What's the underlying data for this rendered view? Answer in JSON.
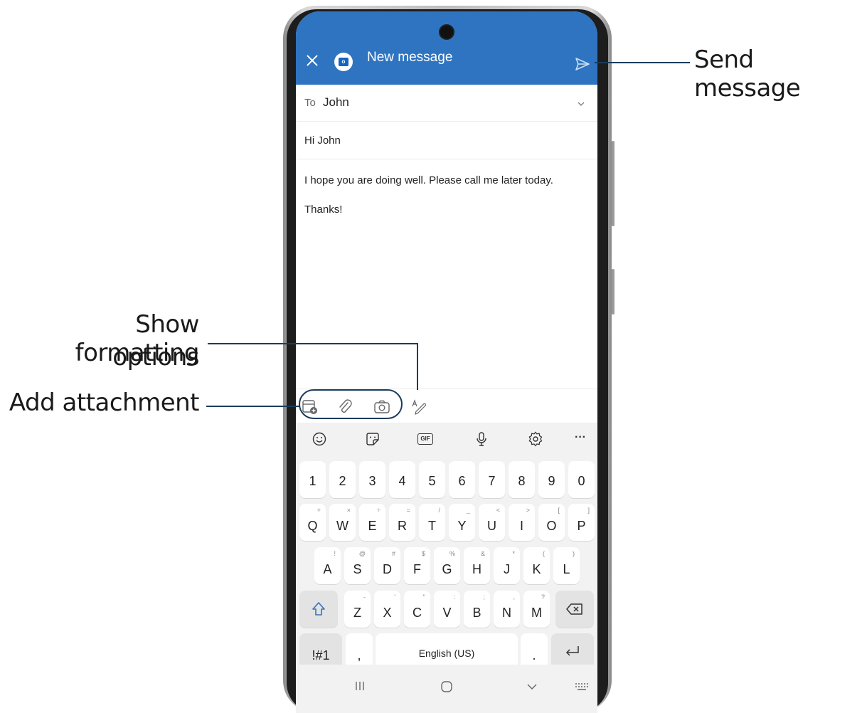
{
  "header": {
    "title": "New message"
  },
  "compose": {
    "to_label": "To",
    "to_value": "John",
    "subject": "Hi John",
    "body_lines": [
      "I hope you are doing well. Please call me later today.",
      "Thanks!"
    ]
  },
  "keyboard": {
    "numbers": [
      "1",
      "2",
      "3",
      "4",
      "5",
      "6",
      "7",
      "8",
      "9",
      "0"
    ],
    "row1": [
      {
        "k": "Q",
        "s": "+"
      },
      {
        "k": "W",
        "s": "×"
      },
      {
        "k": "E",
        "s": "÷"
      },
      {
        "k": "R",
        "s": "="
      },
      {
        "k": "T",
        "s": "/"
      },
      {
        "k": "Y",
        "s": "_"
      },
      {
        "k": "U",
        "s": "<"
      },
      {
        "k": "I",
        "s": ">"
      },
      {
        "k": "O",
        "s": "["
      },
      {
        "k": "P",
        "s": "]"
      }
    ],
    "row2": [
      {
        "k": "A",
        "s": "!"
      },
      {
        "k": "S",
        "s": "@"
      },
      {
        "k": "D",
        "s": "#"
      },
      {
        "k": "F",
        "s": "$"
      },
      {
        "k": "G",
        "s": "%"
      },
      {
        "k": "H",
        "s": "&"
      },
      {
        "k": "J",
        "s": "*"
      },
      {
        "k": "K",
        "s": "("
      },
      {
        "k": "L",
        "s": ")"
      }
    ],
    "row3": [
      {
        "k": "Z",
        "s": "-"
      },
      {
        "k": "X",
        "s": "'"
      },
      {
        "k": "C",
        "s": "\""
      },
      {
        "k": "V",
        "s": ":"
      },
      {
        "k": "B",
        "s": ";"
      },
      {
        "k": "N",
        "s": ","
      },
      {
        "k": "M",
        "s": "?"
      }
    ],
    "symbols_label": "!#1",
    "comma_label": ",",
    "space_label": "English (US)",
    "period_label": ".",
    "gif_label": "GIF",
    "more_label": "···"
  },
  "callouts": {
    "send": "Send message",
    "formatting_line1": "Show formatting",
    "formatting_line2": "options",
    "attachment": "Add attachment"
  },
  "icons": {
    "close": "close-icon",
    "send": "send-icon",
    "attach_file": "attach-file-icon",
    "paperclip": "paperclip-icon",
    "camera": "camera-icon",
    "format": "format-text-icon"
  },
  "colors": {
    "header": "#2f74c0",
    "keyboard_bg": "#f2f2f2",
    "callout_line": "#1a3c5c"
  }
}
